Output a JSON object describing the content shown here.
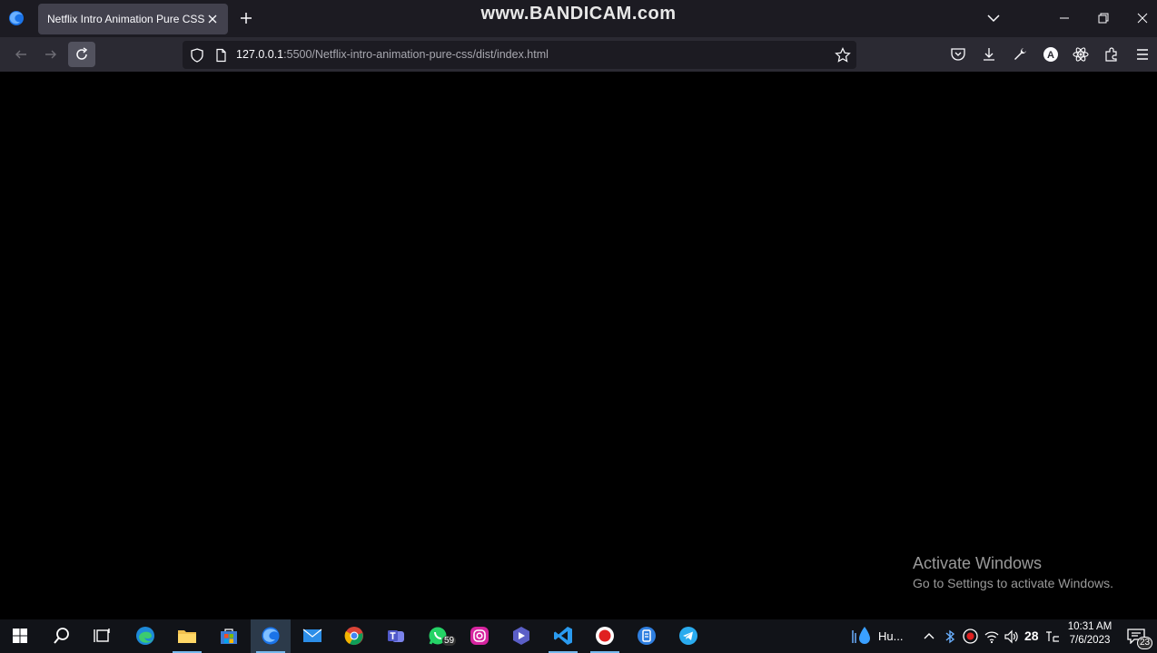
{
  "browser": {
    "tab_title": "Netflix Intro Animation Pure CSS",
    "watermark": "www.BANDICAM.com",
    "url_host": "127.0.0.1",
    "url_rest": ":5500/Netflix-intro-animation-pure-css/dist/index.html"
  },
  "page": {
    "activate_title": "Activate Windows",
    "activate_sub": "Go to Settings to activate Windows."
  },
  "taskbar": {
    "apps": [
      "start-icon",
      "search-icon",
      "task-view-icon",
      "edge-icon",
      "file-explorer-icon",
      "store-icon",
      "firefox-icon",
      "mail-icon",
      "chrome-icon",
      "teams-icon",
      "whatsapp-icon",
      "instagram-icon",
      "app-icon",
      "vscode-icon",
      "record-icon",
      "app2-icon",
      "telegram-icon"
    ],
    "whatsapp_badge": "59",
    "weather_label": "Hu...",
    "temperature": "28",
    "time": "10:31 AM",
    "date": "7/6/2023",
    "notification_count": "23"
  },
  "colors": {
    "tabstrip": "#1c1b22",
    "navbar": "#2b2a33",
    "taskbar": "#111318",
    "accent": "#76b9ed"
  }
}
